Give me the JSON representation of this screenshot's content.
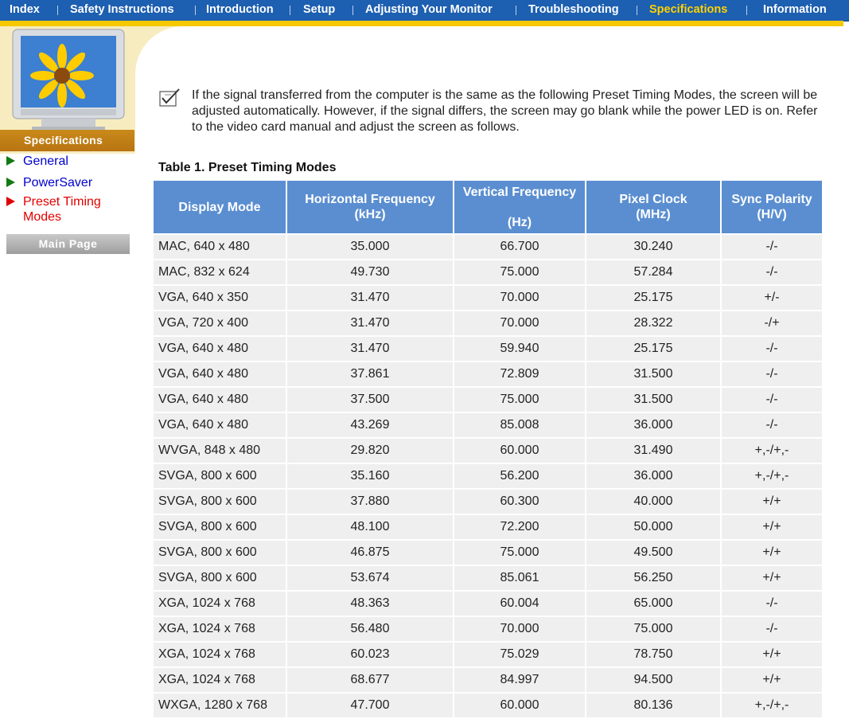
{
  "nav": {
    "items": [
      {
        "label": "Index",
        "active": false
      },
      {
        "label": "Safety  Instructions",
        "active": false
      },
      {
        "label": "Introduction",
        "active": false
      },
      {
        "label": "Setup",
        "active": false
      },
      {
        "label": "Adjusting  Your  Monitor",
        "active": false
      },
      {
        "label": "Troubleshooting",
        "active": false
      },
      {
        "label": "Specifications",
        "active": true
      },
      {
        "label": "Information",
        "active": false
      }
    ]
  },
  "sidebar": {
    "banner": "Specifications",
    "items": [
      {
        "label": "General",
        "active": false
      },
      {
        "label": "PowerSaver",
        "active": false
      },
      {
        "label": "Preset Timing Modes",
        "label_line1": "Preset Timing",
        "label_line2": "Modes",
        "active": true
      }
    ],
    "main_page_label": "Main Page"
  },
  "intro": "If the signal transferred from the computer is the same as the following Preset Timing Modes, the screen will be adjusted automatically. However, if the signal differs, the screen may go blank while the power LED is on. Refer to the video card manual and adjust the screen as follows.",
  "table": {
    "title": "Table 1. Preset Timing Modes",
    "headers": {
      "display_mode": "Display Mode",
      "h_freq": "Horizontal Frequency",
      "h_freq_unit": "(kHz)",
      "v_freq": "Vertical Frequency",
      "v_freq_unit": "(Hz)",
      "pixel_clock": "Pixel Clock",
      "pixel_clock_unit": "(MHz)",
      "sync": "Sync Polarity",
      "sync_unit": "(H/V)"
    },
    "rows": [
      [
        "MAC, 640 x 480",
        "35.000",
        "66.700",
        "30.240",
        "-/-"
      ],
      [
        "MAC, 832 x 624",
        "49.730",
        "75.000",
        "57.284",
        "-/-"
      ],
      [
        "VGA, 640 x 350",
        "31.470",
        "70.000",
        "25.175",
        "+/-"
      ],
      [
        "VGA, 720 x 400",
        "31.470",
        "70.000",
        "28.322",
        "-/+"
      ],
      [
        "VGA, 640 x 480",
        "31.470",
        "59.940",
        "25.175",
        "-/-"
      ],
      [
        "VGA, 640 x 480",
        "37.861",
        "72.809",
        "31.500",
        "-/-"
      ],
      [
        "VGA, 640 x 480",
        "37.500",
        "75.000",
        "31.500",
        "-/-"
      ],
      [
        "VGA, 640 x 480",
        "43.269",
        "85.008",
        "36.000",
        "-/-"
      ],
      [
        "WVGA, 848 x 480",
        "29.820",
        "60.000",
        "31.490",
        "+,-/+,-"
      ],
      [
        "SVGA, 800 x 600",
        "35.160",
        "56.200",
        "36.000",
        "+,-/+,-"
      ],
      [
        "SVGA, 800 x 600",
        "37.880",
        "60.300",
        "40.000",
        "+/+"
      ],
      [
        "SVGA, 800 x 600",
        "48.100",
        "72.200",
        "50.000",
        "+/+"
      ],
      [
        "SVGA, 800 x 600",
        "46.875",
        "75.000",
        "49.500",
        "+/+"
      ],
      [
        "SVGA, 800 x 600",
        "53.674",
        "85.061",
        "56.250",
        "+/+"
      ],
      [
        "XGA, 1024 x 768",
        "48.363",
        "60.004",
        "65.000",
        "-/-"
      ],
      [
        "XGA, 1024 x 768",
        "56.480",
        "70.000",
        "75.000",
        "-/-"
      ],
      [
        "XGA, 1024 x 768",
        "60.023",
        "75.029",
        "78.750",
        "+/+"
      ],
      [
        "XGA, 1024 x 768",
        "68.677",
        "84.997",
        "94.500",
        "+/+"
      ],
      [
        "WXGA, 1280 x 768",
        "47.700",
        "60.000",
        "80.136",
        "+,-/+,-"
      ]
    ]
  },
  "colors": {
    "nav_bg": "#1d5fb0",
    "nav_active": "#ffd200",
    "accent_orange": "#f6c800",
    "table_header": "#5a8ed0",
    "row_bg": "#efefef",
    "link": "#0000cc",
    "link_active": "#e00000"
  }
}
